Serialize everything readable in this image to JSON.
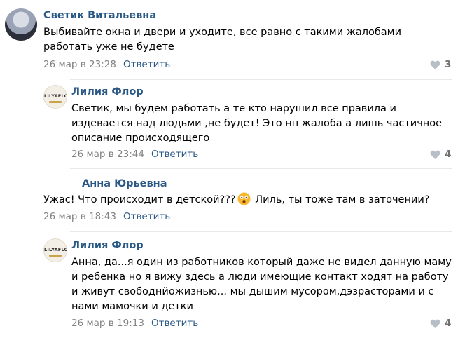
{
  "comments": [
    {
      "author": "Светик Витальевна",
      "text": "Выбивайте окна и двери и уходите, все равно с такими жалобами работать уже не будете",
      "date": "26 мар в 23:28",
      "reply_label": "Ответить",
      "likes": "3"
    },
    {
      "author": "Лилия Флор",
      "avatar_logo": "LILYAFLOR",
      "text": "Светик, мы будем работать а те кто нарушил все правила и издевается над людьми ,не будет! Это нп жалоба а лишь частичное описание происходящего",
      "date": "26 мар в 23:44",
      "reply_label": "Ответить",
      "likes": "4"
    },
    {
      "author": "Анна Юрьевна",
      "text_before": "Ужас! Что происходит в детской???",
      "text_after": " Лиль, ты тоже там в заточении?",
      "emoji": "astonished-face-emoji",
      "date": "26 мар в 18:43",
      "reply_label": "Ответить"
    },
    {
      "author": "Лилия Флор",
      "avatar_logo": "LILYAFLOR",
      "text": "Анна, да...я один из работников который даже не видел данную маму и ребенка но я вижу здесь а люди имеющие контакт ходят на работу и живут свободнйожизнью... мы дышим мусором,дэзрасторами и с нами мамочки и детки",
      "date": "26 мар в 19:13",
      "reply_label": "Ответить",
      "likes": "4"
    }
  ],
  "icons": {
    "like": "heart-icon"
  },
  "colors": {
    "link": "#2a5885",
    "meta": "#828282",
    "divider": "#e7e8ec"
  }
}
